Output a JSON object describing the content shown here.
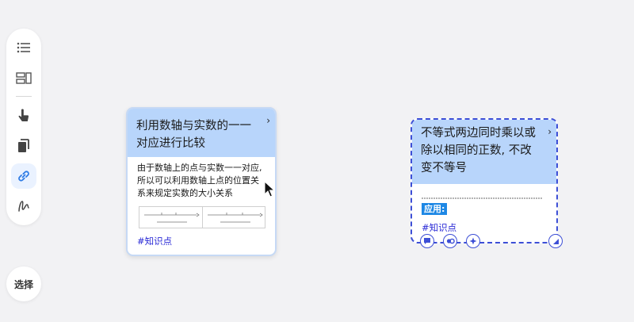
{
  "toolbar": {
    "tools": [
      {
        "name": "list-view-icon"
      },
      {
        "name": "card-layout-icon"
      },
      {
        "name": "pointer-hand-icon"
      },
      {
        "name": "copy-pages-icon"
      },
      {
        "name": "link-icon",
        "active": true
      },
      {
        "name": "freehand-draw-icon"
      }
    ],
    "select_label": "选择"
  },
  "cards": [
    {
      "title": "利用数轴与实数的一一对应进行比较",
      "body": "由于数轴上的点与实数一一对应,所以可以利用数轴上点的位置关系来规定实数的大小关系",
      "tag": "#知识点"
    },
    {
      "title": "不等式两边同时乘以或除以相同的正数, 不改变不等号",
      "badge": "应用:",
      "tag": "#知识点"
    }
  ],
  "colors": {
    "card_header": "#b8d5fb",
    "accent": "#3d4fd6",
    "tag": "#2b2bd6",
    "badge": "#1e88e5"
  }
}
